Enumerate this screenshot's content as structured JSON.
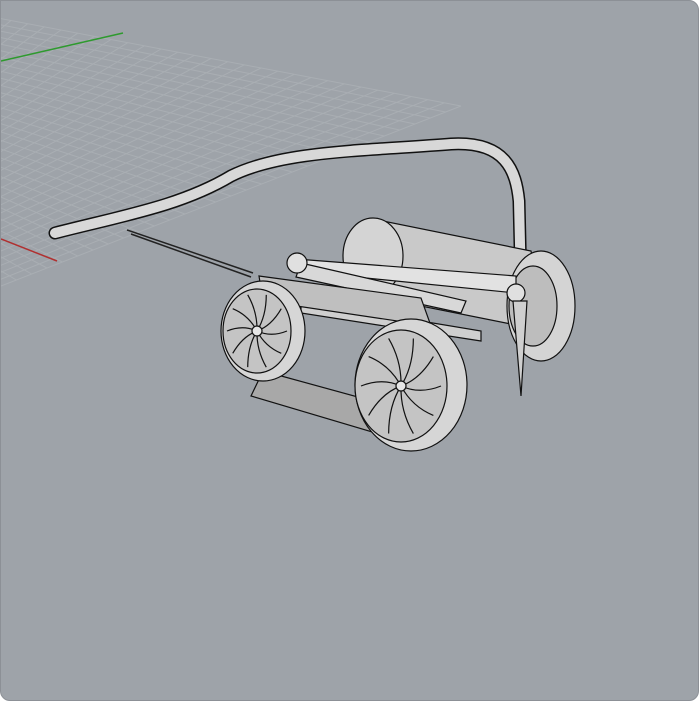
{
  "viewport": {
    "name": "",
    "display_mode": "Shaded",
    "background_color": "#9ea3a9",
    "grid_color": "#a9aeb3",
    "axis_x_color": "#b03030",
    "axis_y_color": "#2e9a2e",
    "model_fill_color": "#dcdcdc",
    "model_edge_color": "#000000",
    "object_icon": "crawler-vehicle-model-icon"
  }
}
